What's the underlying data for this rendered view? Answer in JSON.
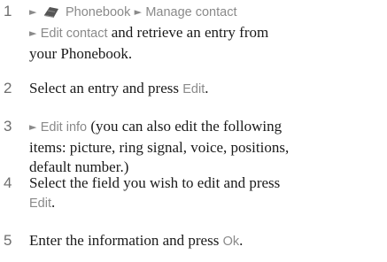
{
  "steps": [
    {
      "number": "1",
      "menu_path": "Phonebook",
      "menu_path_2": "Manage contact",
      "menu_path_3": "Edit contact",
      "text": "and retrieve an entry from your Phonebook.",
      "text_line1": "and retrieve an entry from",
      "text_line2": "your Phonebook."
    },
    {
      "number": "2",
      "text": "Select an entry and press",
      "key": "Edit",
      "end": "."
    },
    {
      "number": "3",
      "menu_path": "Edit info",
      "text_line1": "(you can also edit the following",
      "text_line2": "items: picture, ring signal, voice, positions,",
      "text_line3": "default number.)"
    },
    {
      "number": "4",
      "text_line1": "Select the field you wish to edit and press",
      "key": "Edit",
      "end": "."
    },
    {
      "number": "5",
      "text": "Enter the information and press",
      "key": "Ok",
      "end": "."
    }
  ],
  "icons": {
    "arrow": "right-arrow-icon",
    "phonebook": "phonebook-icon"
  },
  "colors": {
    "ui_text": "#8a8a8a",
    "step_number": "#6e6e6e",
    "body_text": "#1a1a1a"
  }
}
